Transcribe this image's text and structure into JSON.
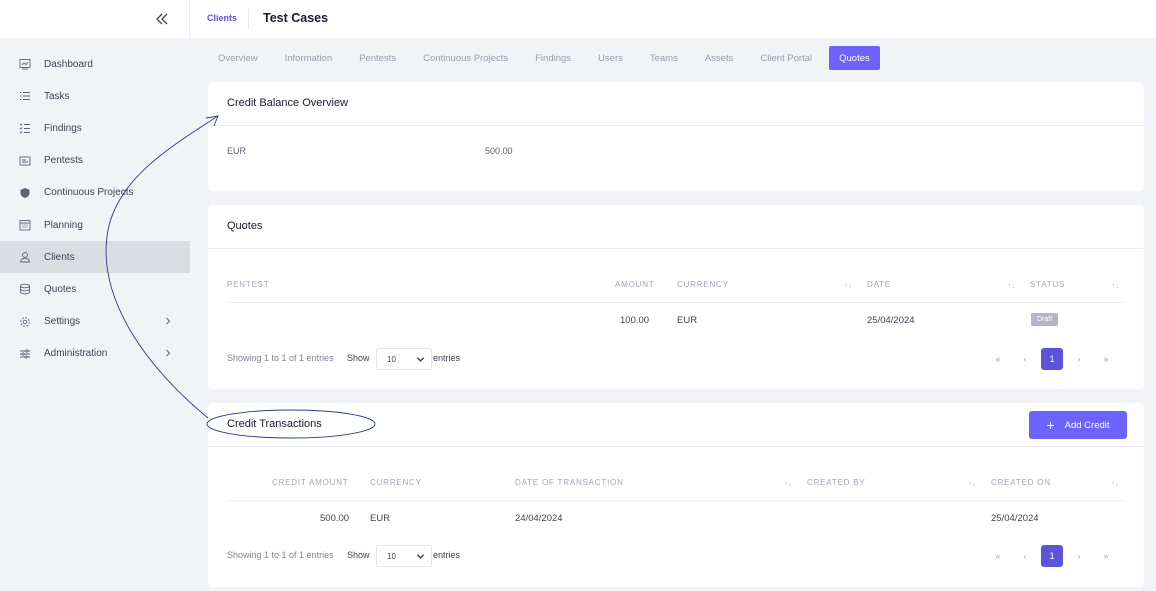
{
  "sidebar": {
    "items": [
      {
        "label": "Dashboard",
        "icon": "dashboard-icon"
      },
      {
        "label": "Tasks",
        "icon": "tasks-icon"
      },
      {
        "label": "Findings",
        "icon": "findings-icon"
      },
      {
        "label": "Pentests",
        "icon": "pentests-icon"
      },
      {
        "label": "Continuous Projects",
        "icon": "shield-icon"
      },
      {
        "label": "Planning",
        "icon": "calendar-icon"
      },
      {
        "label": "Clients",
        "icon": "clients-icon"
      },
      {
        "label": "Quotes",
        "icon": "coins-icon"
      },
      {
        "label": "Settings",
        "icon": "gear-icon"
      },
      {
        "label": "Administration",
        "icon": "sliders-icon"
      }
    ]
  },
  "header": {
    "breadcrumb": "Clients",
    "title": "Test Cases"
  },
  "tabs": [
    {
      "label": "Overview"
    },
    {
      "label": "Information"
    },
    {
      "label": "Pentests"
    },
    {
      "label": "Continuous Projects"
    },
    {
      "label": "Findings"
    },
    {
      "label": "Users"
    },
    {
      "label": "Teams"
    },
    {
      "label": "Assets"
    },
    {
      "label": "Client Portal"
    },
    {
      "label": "Quotes"
    }
  ],
  "credit_balance": {
    "title": "Credit Balance Overview",
    "currency": "EUR",
    "amount": "500.00"
  },
  "quotes": {
    "title": "Quotes",
    "columns": {
      "pentest": "PENTEST",
      "amount": "AMOUNT",
      "currency": "CURRENCY",
      "date": "DATE",
      "status": "STATUS"
    },
    "rows": [
      {
        "pentest": "",
        "amount": "100.00",
        "currency": "EUR",
        "date": "25/04/2024",
        "status": "Draft"
      }
    ],
    "info": "Showing 1 to 1 of 1 entries",
    "show_label": "Show",
    "page_size": "10",
    "entries_label": "entries",
    "pager": {
      "first": "«",
      "prev": "‹",
      "page": "1",
      "next": "›",
      "last": "»"
    }
  },
  "credit_transactions": {
    "title": "Credit Transactions",
    "add_button": "Add Credit",
    "columns": {
      "credit_amount": "CREDIT AMOUNT",
      "currency": "CURRENCY",
      "date": "DATE OF TRANSACTION",
      "created_by": "CREATED BY",
      "created_on": "CREATED ON"
    },
    "rows": [
      {
        "credit_amount": "500.00",
        "currency": "EUR",
        "date": "24/04/2024",
        "created_by": "",
        "created_on": "25/04/2024"
      }
    ],
    "info": "Showing 1 to 1 of 1 entries",
    "show_label": "Show",
    "page_size": "10",
    "entries_label": "entries",
    "pager": {
      "first": "«",
      "prev": "‹",
      "page": "1",
      "next": "›",
      "last": "»"
    }
  },
  "colors": {
    "accent": "#6c63ff",
    "annotation": "#2c3a8c"
  }
}
